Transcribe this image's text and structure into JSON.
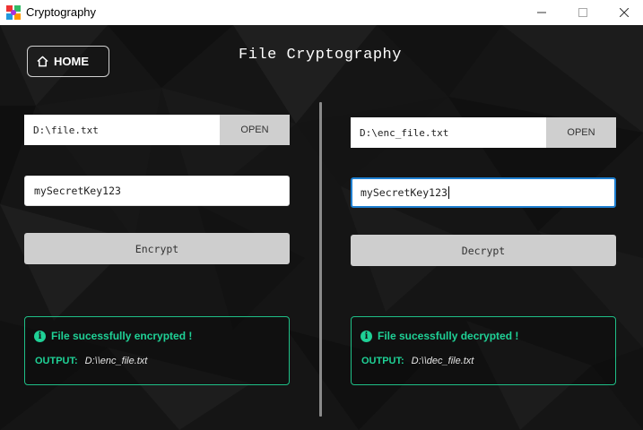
{
  "window": {
    "title": "Cryptography",
    "minimize_glyph": "—",
    "maximize_glyph": "☐",
    "close_glyph": "✕"
  },
  "header": {
    "home_label": "HOME",
    "page_title": "File Cryptography"
  },
  "encrypt_panel": {
    "file_path": "D:\\file.txt",
    "open_label": "OPEN",
    "key_value": "mySecretKey123",
    "action_label": "Encrypt",
    "status_message": "File sucessfully encrypted !",
    "output_label": "OUTPUT:",
    "output_value": "D:\\\\enc_file.txt"
  },
  "decrypt_panel": {
    "file_path": "D:\\enc_file.txt",
    "open_label": "OPEN",
    "key_value": "mySecretKey123",
    "action_label": "Decrypt",
    "status_message": "File sucessfully decrypted !",
    "output_label": "OUTPUT:",
    "output_value": "D:\\\\dec_file.txt"
  },
  "colors": {
    "background": "#141414",
    "success": "#1fd196",
    "button": "#cecece",
    "focus": "#1e7fd0"
  },
  "icons": {
    "app": "app-logo-icon",
    "home": "home-icon",
    "info": "info-icon"
  }
}
